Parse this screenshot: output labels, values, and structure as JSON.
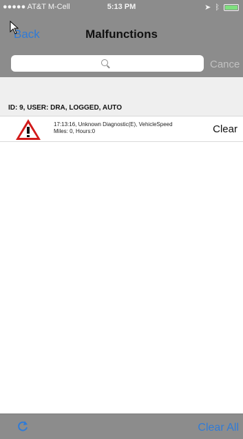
{
  "status": {
    "carrier": "●●●●● AT&T M-Cell",
    "time": "5:13 PM"
  },
  "nav": {
    "back_label": "Back",
    "title": "Malfunctions"
  },
  "search": {
    "placeholder": "",
    "cancel_label": "Cance"
  },
  "section": {
    "header": "ID: 9, USER: DRA, LOGGED, AUTO",
    "rows": [
      {
        "line1": "17:13:16, Unknown Diagnostic(E), VehicleSpeed",
        "line2": "Miles: 0, Hours:0",
        "action": "Clear"
      }
    ]
  },
  "toolbar": {
    "clear_all_label": "Clear All"
  },
  "colors": {
    "accent": "#2f7bd8",
    "warning_red": "#d21a1a",
    "bar_gray": "#8c8c8c"
  },
  "icons": [
    "search-icon",
    "warning-icon",
    "refresh-icon",
    "battery-icon",
    "wifi-icon",
    "location-icon",
    "bluetooth-icon"
  ]
}
